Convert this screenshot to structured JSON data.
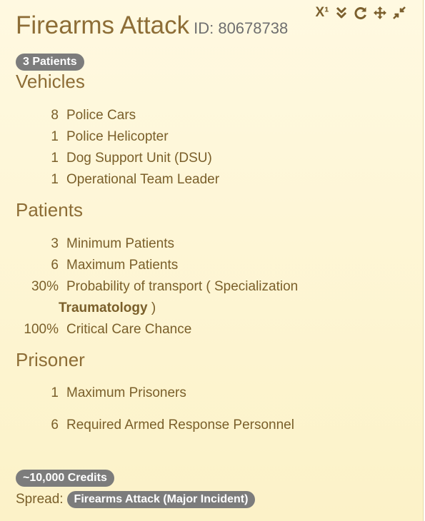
{
  "header": {
    "title": "Firearms Attack",
    "id_text": "ID: 80678738"
  },
  "toolbar": {
    "superscript_label": "X¹",
    "icons": [
      "superscript-icon",
      "chevron-double-down-icon",
      "refresh-icon",
      "move-icon",
      "minimize-icon"
    ]
  },
  "patients_badge": "3 Patients",
  "vehicles": {
    "title": "Vehicles",
    "items": [
      {
        "count": "8",
        "label": "Police Cars"
      },
      {
        "count": "1",
        "label": "Police Helicopter"
      },
      {
        "count": "1",
        "label": "Dog Support Unit (DSU)"
      },
      {
        "count": "1",
        "label": "Operational Team Leader"
      }
    ]
  },
  "patients": {
    "title": "Patients",
    "min": {
      "count": "3",
      "label": "Minimum Patients"
    },
    "max": {
      "count": "6",
      "label": "Maximum Patients"
    },
    "transport": {
      "count": "30%",
      "label": "Probability of transport ( Specialization",
      "specialization": "Traumatology",
      "close": ")"
    },
    "critical": {
      "count": "100%",
      "label": "Critical Care Chance"
    }
  },
  "prisoner": {
    "title": "Prisoner",
    "items": [
      {
        "count": "1",
        "label": "Maximum Prisoners"
      },
      {
        "count": "6",
        "label": "Required Armed Response Personnel"
      }
    ]
  },
  "footer": {
    "credits": "~10,000 Credits",
    "spread_label": "Spread:",
    "spread_value": "Firearms Attack (Major Incident)"
  },
  "colors": {
    "background_top": "#fff9e1",
    "background_bottom": "#fcf2c8",
    "heading": "#8d6d36",
    "text": "#7a5f2a",
    "badge": "#7c7c7c"
  }
}
